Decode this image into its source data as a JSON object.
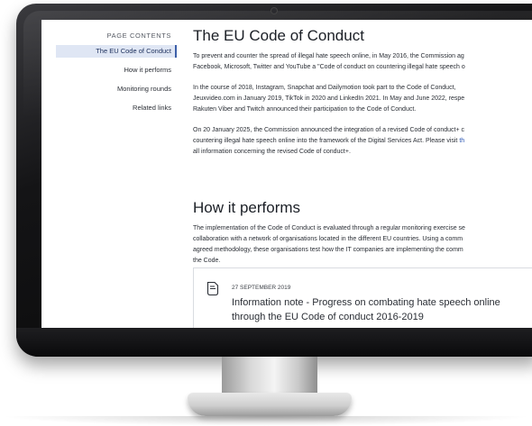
{
  "sidebar": {
    "title": "PAGE CONTENTS",
    "items": [
      {
        "label": "The EU Code of Conduct",
        "active": true
      },
      {
        "label": "How it performs",
        "active": false
      },
      {
        "label": "Monitoring rounds",
        "active": false
      },
      {
        "label": "Related links",
        "active": false
      }
    ]
  },
  "section1": {
    "heading": "The EU Code of Conduct",
    "p1": [
      "To prevent and counter the spread of illegal hate speech online, in May 2016, the Commission ag",
      "Facebook, Microsoft, Twitter and YouTube a \"Code of conduct on countering illegal hate speech o"
    ],
    "p2": [
      "In the course of 2018, Instagram, Snapchat and Dailymotion took part to the Code of Conduct,",
      "Jeuxvideo.com in January 2019, TikTok in 2020 and LinkedIn 2021. In May and June 2022, respe",
      "Rakuten Viber and Twitch announced their participation to the Code of Conduct."
    ],
    "p3_line1": "On 20 January 2025, the Commission announced the integration of a revised Code of conduct+ c",
    "p3_line2_text": "countering illegal hate speech online into the framework of the Digital Services Act. Please visit ",
    "p3_line2_link": "th",
    "p3_line3": "all information concerning the revised Code of conduct+."
  },
  "section2": {
    "heading": "How it performs",
    "p1": [
      "The implementation of the Code of Conduct is evaluated through a regular monitoring exercise se",
      "collaboration with a network of organisations located in the different EU countries. Using a comm",
      "agreed methodology, these organisations test how the IT companies are implementing the comm",
      "the Code."
    ]
  },
  "publication": {
    "date": "27 SEPTEMBER 2019",
    "title_lines": [
      "Information note - Progress on combating hate speech online",
      "through the EU Code of conduct 2016-2019"
    ],
    "icon": "document-icon"
  },
  "colors": {
    "accent": "#3c5fa8",
    "active_bg": "#dfe6f4",
    "link": "#2e58b5"
  }
}
